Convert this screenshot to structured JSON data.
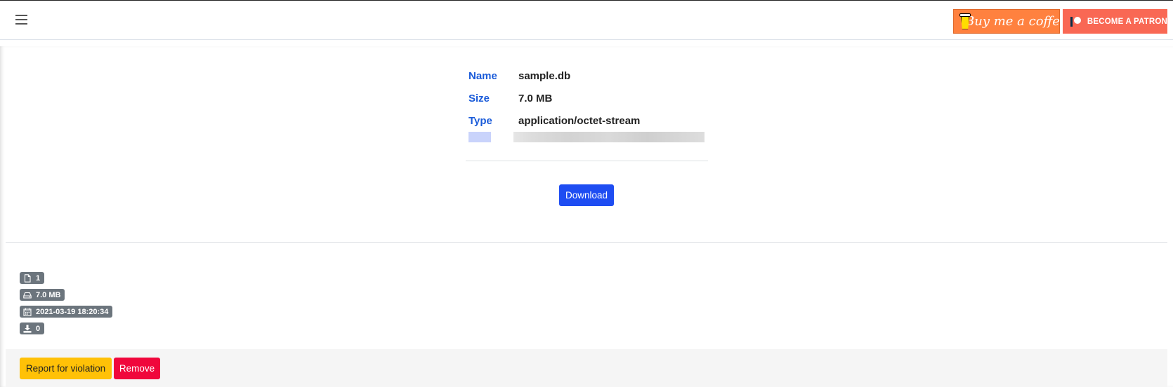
{
  "header": {
    "menu_icon": "hamburger-menu-icon",
    "coffee_label": "Buy me a coffee",
    "patron_label": "BECOME A PATRON",
    "colors": {
      "coffee": "#ff813f",
      "patron": "#f96854"
    }
  },
  "file_info": {
    "rows": [
      {
        "key": "Name",
        "value": "sample.db"
      },
      {
        "key": "Size",
        "value": "7.0 MB"
      },
      {
        "key": "Type",
        "value": "application/octet-stream"
      }
    ]
  },
  "actions": {
    "download_label": "Download",
    "report_label": "Report for violation",
    "remove_label": "Remove"
  },
  "stats": {
    "file_count": "1",
    "total_size": "7.0 MB",
    "uploaded_at": "2021-03-19 18:20:34",
    "downloads": "0",
    "icons": [
      "file-icon",
      "hard-drive-icon",
      "calendar-icon",
      "download-icon"
    ]
  },
  "colors": {
    "accent_blue": "#1e4df2",
    "label_blue": "#1a5bd9",
    "badge_gray": "#6c757d",
    "warning_yellow": "#ffc107",
    "danger_red": "#f0073c"
  }
}
